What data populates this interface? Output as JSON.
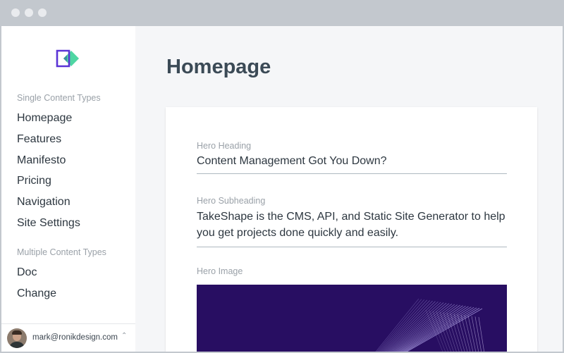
{
  "sidebar": {
    "single_section_label": "Single Content Types",
    "single_items": [
      "Homepage",
      "Features",
      "Manifesto",
      "Pricing",
      "Navigation",
      "Site Settings"
    ],
    "multiple_section_label": "Multiple Content Types",
    "multiple_items": [
      "Doc",
      "Change"
    ]
  },
  "user": {
    "email": "mark@ronikdesign.com",
    "caret_icon": "chevron-up-icon"
  },
  "main": {
    "title": "Homepage",
    "fields": {
      "hero_heading": {
        "label": "Hero Heading",
        "value": "Content Management Got You Down?"
      },
      "hero_subheading": {
        "label": "Hero Subheading",
        "value": "TakeShape is the CMS, API, and Static Site Generator to help you get projects done quickly and easily."
      },
      "hero_image": {
        "label": "Hero Image"
      }
    }
  },
  "colors": {
    "brand_purple": "#5b34d6",
    "brand_green": "#4fd6a3",
    "hero_bg": "#280e62"
  }
}
